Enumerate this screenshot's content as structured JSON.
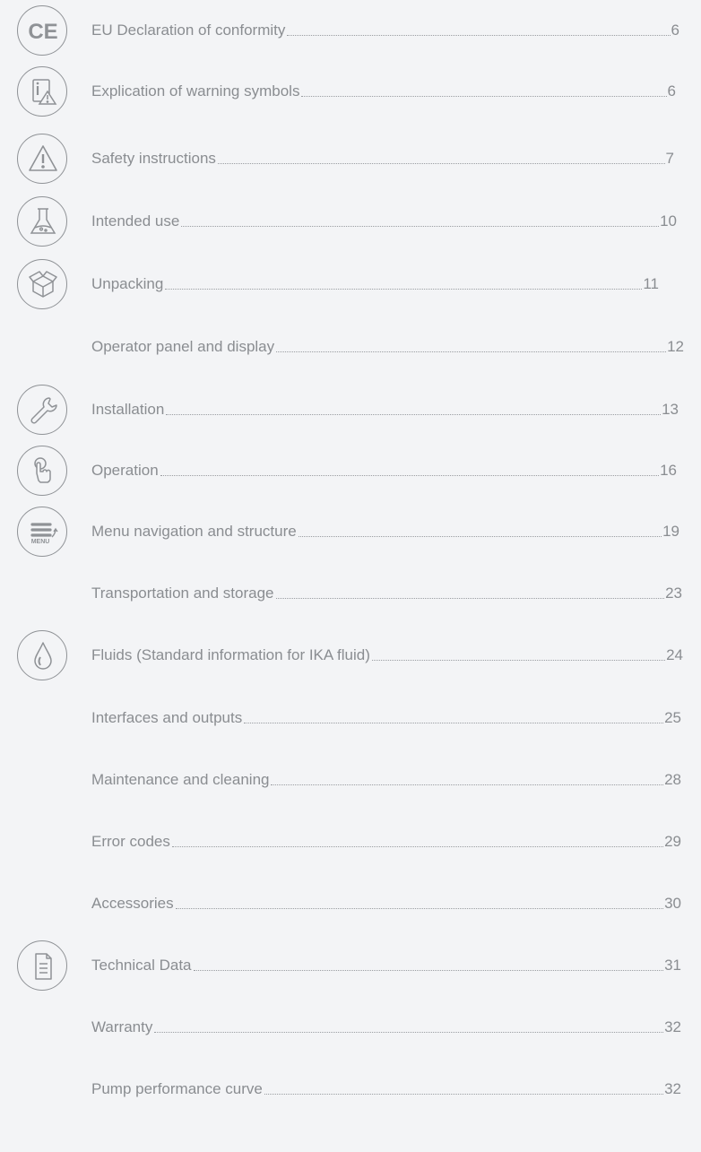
{
  "toc": [
    {
      "title": "EU Declaration of conformity",
      "page": "6",
      "icon": "ce-mark-icon"
    },
    {
      "title": "Explication of warning symbols",
      "page": "6",
      "icon": "info-warning-icon"
    },
    {
      "title": "Safety instructions",
      "page": "7",
      "icon": "warning-triangle-icon"
    },
    {
      "title": "Intended use",
      "page": "10",
      "icon": "flask-icon"
    },
    {
      "title": "Unpacking",
      "page": "11",
      "icon": "box-icon"
    },
    {
      "title": "Operator panel and display",
      "page": "12",
      "icon": ""
    },
    {
      "title": "Installation",
      "page": "13",
      "icon": "wrench-icon"
    },
    {
      "title": "Operation",
      "page": "16",
      "icon": "touch-hand-icon"
    },
    {
      "title": "Menu navigation and structure",
      "page": "19",
      "icon": "menu-icon"
    },
    {
      "title": "Transportation and storage",
      "page": "23",
      "icon": ""
    },
    {
      "title": "Fluids (Standard information for IKA fluid)",
      "page": "24",
      "icon": "drop-icon"
    },
    {
      "title": "Interfaces and outputs",
      "page": "25",
      "icon": ""
    },
    {
      "title": "Maintenance and cleaning",
      "page": "28",
      "icon": ""
    },
    {
      "title": "Error codes",
      "page": "29",
      "icon": ""
    },
    {
      "title": "Accessories",
      "page": "30",
      "icon": ""
    },
    {
      "title": "Technical Data",
      "page": "31",
      "icon": "document-icon"
    },
    {
      "title": "Warranty",
      "page": "32",
      "icon": ""
    },
    {
      "title": "Pump performance curve",
      "page": "32",
      "icon": ""
    }
  ],
  "icon_text": {
    "ce": "CE",
    "menu": "MENU"
  }
}
